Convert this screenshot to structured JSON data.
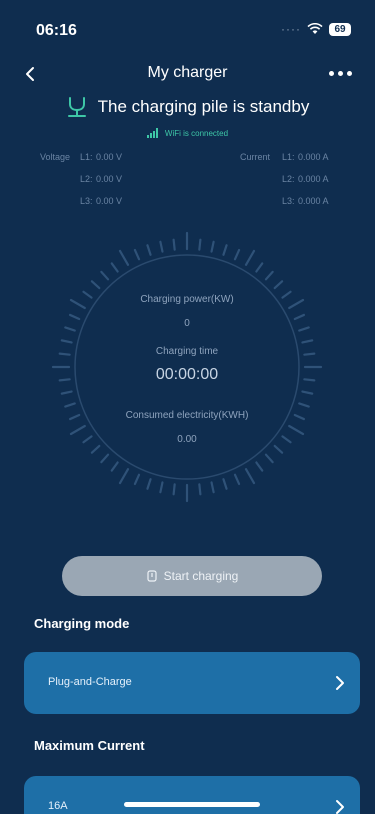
{
  "status_bar": {
    "time": "06:16",
    "battery": "69"
  },
  "nav": {
    "title": "My charger"
  },
  "charger": {
    "state_text": "The charging pile is standby",
    "wifi_text": "WiFi is connected"
  },
  "readings": {
    "voltage_label": "Voltage",
    "voltage": [
      {
        "phase": "L1:",
        "value": "0.00 V"
      },
      {
        "phase": "L2:",
        "value": "0.00 V"
      },
      {
        "phase": "L3:",
        "value": "0.00 V"
      }
    ],
    "current_label": "Current",
    "current": [
      {
        "phase": "L1:",
        "value": "0.000 A"
      },
      {
        "phase": "L2:",
        "value": "0.000 A"
      },
      {
        "phase": "L3:",
        "value": "0.000 A"
      }
    ]
  },
  "dial": {
    "power_label": "Charging power(KW)",
    "power_value": "0",
    "time_label": "Charging time",
    "time_value": "00:00:00",
    "energy_label": "Consumed electricity(KWH)",
    "energy_value": "0.00"
  },
  "actions": {
    "start_label": "Start charging"
  },
  "charging_mode": {
    "title": "Charging mode",
    "value": "Plug-and-Charge"
  },
  "maximum_current": {
    "title": "Maximum Current",
    "value": "16A"
  },
  "colors": {
    "background": "#0f2d4f",
    "card": "#1e6fa7",
    "accent": "#3ec7a7",
    "button_disabled": "#9aa7b4"
  },
  "icons": [
    "chevron-left-icon",
    "more-icon",
    "charging-pile-icon",
    "wifi-signal-icon",
    "power-icon",
    "chevron-right-icon"
  ]
}
